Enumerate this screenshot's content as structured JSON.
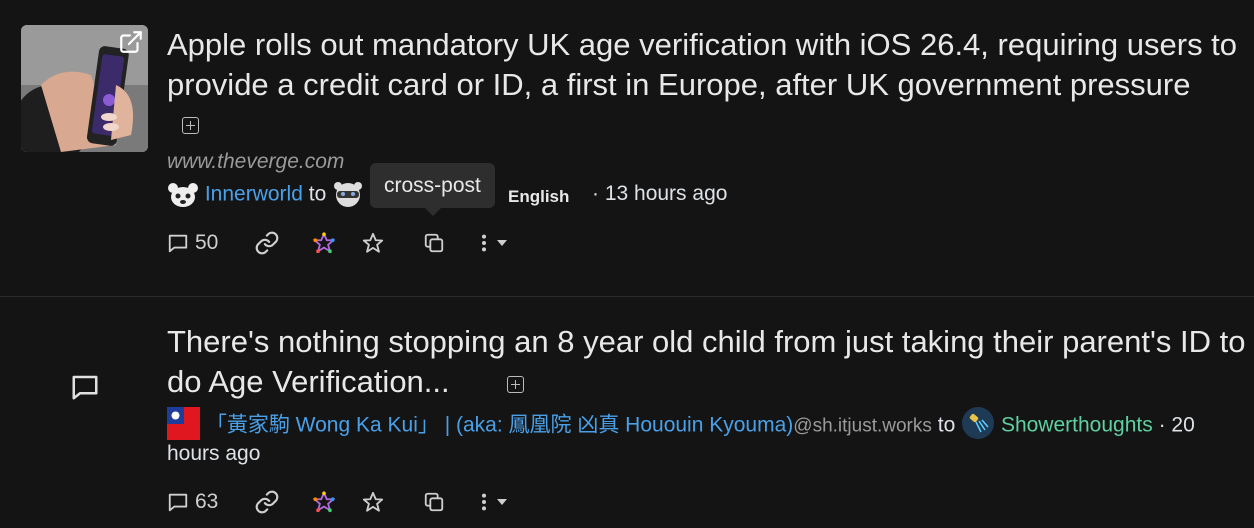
{
  "posts": [
    {
      "title": "Apple rolls out mandatory UK age verification with iOS 26.4, requiring users to provide a credit card or ID, a first in Europe, after UK government pressure",
      "domain": "www.theverge.com",
      "author": "Innerworld",
      "to": "to",
      "language": "English",
      "time": "· 13 hours ago",
      "comments": "50",
      "tooltip": "cross-post"
    },
    {
      "title": "There's nothing stopping an 8 year old child from just taking their parent's ID to do Age Verification...",
      "author": "「黃家駒 Wong Ka Kui」 | (aka: 鳳凰院 凶真 Hououin Kyouma)",
      "author_instance": "@sh.itjust.works",
      "to": "to",
      "community": "Showerthoughts",
      "time_part1": "· 20",
      "time_part2": "hours ago",
      "comments": "63"
    }
  ],
  "icons": {
    "comment": "comment-icon",
    "link": "link-icon",
    "fediverse": "fediverse-icon",
    "star": "star-icon",
    "crosspost": "crosspost-icon",
    "more": "more-icon",
    "dropdown": "chevron-down-icon"
  },
  "colors": {
    "background": "#141414",
    "link": "#4aa0e8",
    "community_green": "#5fd0a0",
    "tooltip_bg": "#2e2e2e"
  }
}
